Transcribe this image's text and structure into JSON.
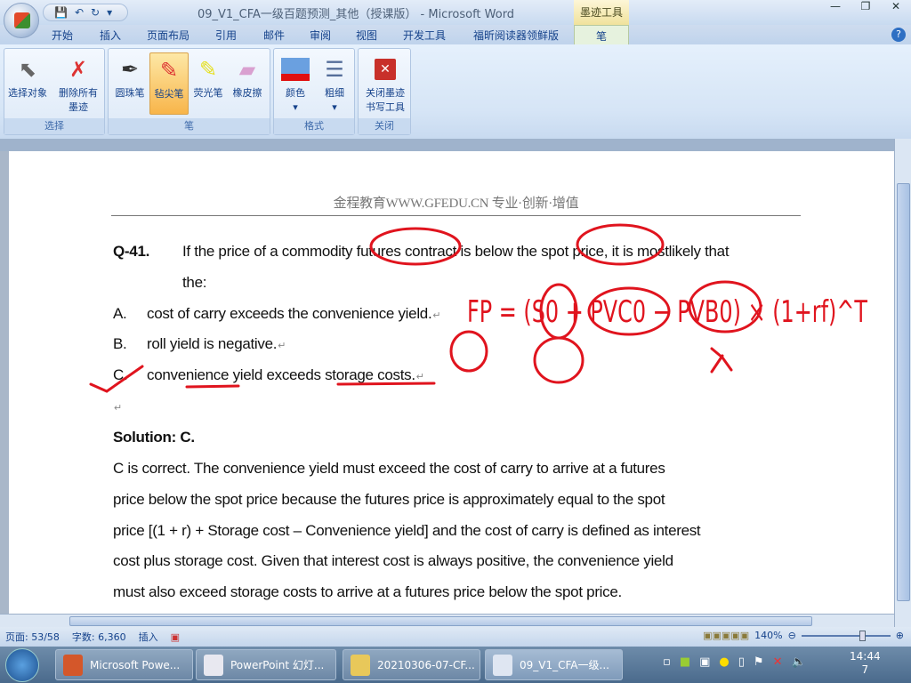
{
  "window": {
    "title": "09_V1_CFA一级百题预测_其他（授课版） - Microsoft Word",
    "context_tab": "墨迹工具",
    "help": "?"
  },
  "qat": {
    "save": "💾",
    "undo": "↶",
    "redo": "↻",
    "more": "▾"
  },
  "tabs": [
    "开始",
    "插入",
    "页面布局",
    "引用",
    "邮件",
    "审阅",
    "视图",
    "开发工具",
    "福昕阅读器领鲜版"
  ],
  "active_tab": "笔",
  "ribbon": {
    "groups": [
      {
        "label": "选择",
        "buttons": [
          "选择对象",
          "删除所有墨迹"
        ]
      },
      {
        "label": "笔",
        "buttons": [
          "圆珠笔",
          "毡尖笔",
          "荧光笔",
          "橡皮擦"
        ]
      },
      {
        "label": "格式",
        "buttons": [
          "颜色",
          "粗细"
        ]
      },
      {
        "label": "关闭",
        "buttons": [
          "关闭墨迹书写工具"
        ]
      }
    ]
  },
  "document": {
    "header": "金程教育WWW.GFEDU.CN 专业·创新·增值",
    "question": {
      "number": "Q-41.",
      "text_line1": "If the price of a commodity futures contract is below the spot price, it is mostlikely that",
      "text_line2": "the:"
    },
    "options": [
      {
        "letter": "A.",
        "text": "cost of carry exceeds the convenience yield."
      },
      {
        "letter": "B.",
        "text": "roll yield is negative."
      },
      {
        "letter": "C.",
        "text": "convenience yield exceeds storage costs."
      }
    ],
    "solution_title": "Solution: C.",
    "solution_lines": [
      "C is correct. The convenience yield must exceed the cost of carry to arrive at a futures",
      "price below the spot price because the futures price is approximately equal to the spot",
      "price [(1 + r) + Storage cost – Convenience yield] and the cost of carry is defined as interest",
      "cost plus storage cost. Given that interest cost is always positive, the convenience yield",
      "must also exceed storage costs to arrive at a futures price below the spot price."
    ],
    "para_mark": "↵",
    "ink_formula": "FP = (S0 + PVC0 − PVB0) × (1+rf)^T",
    "ink_color": "#e0141e"
  },
  "status": {
    "page": "页面: 53/58",
    "words": "字数: 6,360",
    "mode": "插入",
    "zoom": "140%"
  },
  "taskbar": {
    "items": [
      "Microsoft Powe...",
      "PowerPoint 幻灯...",
      "20210306-07-CF...",
      "09_V1_CFA一级..."
    ],
    "time": "14:44",
    "date": "7"
  }
}
